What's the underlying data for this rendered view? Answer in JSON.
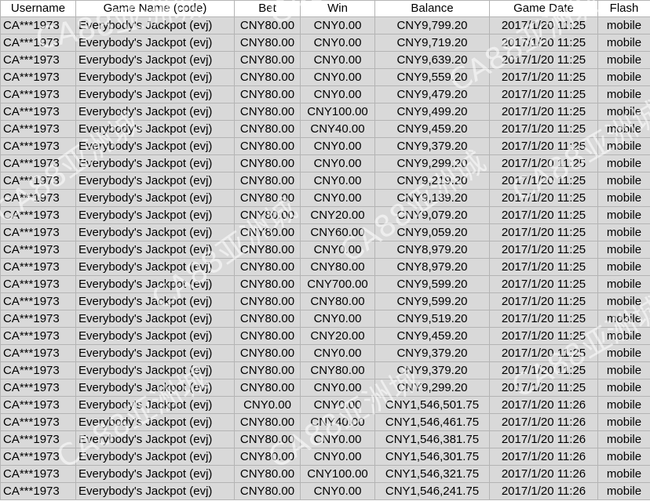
{
  "columns": [
    "Username",
    "Game Name (code)",
    "Bet",
    "Win",
    "Balance",
    "Game Date",
    "Flash"
  ],
  "rows": [
    [
      "CA***1973",
      "Everybody's Jackpot (evj)",
      "CNY80.00",
      "CNY0.00",
      "CNY9,799.20",
      "2017/1/20 11:25",
      "mobile"
    ],
    [
      "CA***1973",
      "Everybody's Jackpot (evj)",
      "CNY80.00",
      "CNY0.00",
      "CNY9,719.20",
      "2017/1/20 11:25",
      "mobile"
    ],
    [
      "CA***1973",
      "Everybody's Jackpot (evj)",
      "CNY80.00",
      "CNY0.00",
      "CNY9,639.20",
      "2017/1/20 11:25",
      "mobile"
    ],
    [
      "CA***1973",
      "Everybody's Jackpot (evj)",
      "CNY80.00",
      "CNY0.00",
      "CNY9,559.20",
      "2017/1/20 11:25",
      "mobile"
    ],
    [
      "CA***1973",
      "Everybody's Jackpot (evj)",
      "CNY80.00",
      "CNY0.00",
      "CNY9,479.20",
      "2017/1/20 11:25",
      "mobile"
    ],
    [
      "CA***1973",
      "Everybody's Jackpot (evj)",
      "CNY80.00",
      "CNY100.00",
      "CNY9,499.20",
      "2017/1/20 11:25",
      "mobile"
    ],
    [
      "CA***1973",
      "Everybody's Jackpot (evj)",
      "CNY80.00",
      "CNY40.00",
      "CNY9,459.20",
      "2017/1/20 11:25",
      "mobile"
    ],
    [
      "CA***1973",
      "Everybody's Jackpot (evj)",
      "CNY80.00",
      "CNY0.00",
      "CNY9,379.20",
      "2017/1/20 11:25",
      "mobile"
    ],
    [
      "CA***1973",
      "Everybody's Jackpot (evj)",
      "CNY80.00",
      "CNY0.00",
      "CNY9,299.20",
      "2017/1/20 11:25",
      "mobile"
    ],
    [
      "CA***1973",
      "Everybody's Jackpot (evj)",
      "CNY80.00",
      "CNY0.00",
      "CNY9,219.20",
      "2017/1/20 11:25",
      "mobile"
    ],
    [
      "CA***1973",
      "Everybody's Jackpot (evj)",
      "CNY80.00",
      "CNY0.00",
      "CNY9,139.20",
      "2017/1/20 11:25",
      "mobile"
    ],
    [
      "CA***1973",
      "Everybody's Jackpot (evj)",
      "CNY80.00",
      "CNY20.00",
      "CNY9,079.20",
      "2017/1/20 11:25",
      "mobile"
    ],
    [
      "CA***1973",
      "Everybody's Jackpot (evj)",
      "CNY80.00",
      "CNY60.00",
      "CNY9,059.20",
      "2017/1/20 11:25",
      "mobile"
    ],
    [
      "CA***1973",
      "Everybody's Jackpot (evj)",
      "CNY80.00",
      "CNY0.00",
      "CNY8,979.20",
      "2017/1/20 11:25",
      "mobile"
    ],
    [
      "CA***1973",
      "Everybody's Jackpot (evj)",
      "CNY80.00",
      "CNY80.00",
      "CNY8,979.20",
      "2017/1/20 11:25",
      "mobile"
    ],
    [
      "CA***1973",
      "Everybody's Jackpot (evj)",
      "CNY80.00",
      "CNY700.00",
      "CNY9,599.20",
      "2017/1/20 11:25",
      "mobile"
    ],
    [
      "CA***1973",
      "Everybody's Jackpot (evj)",
      "CNY80.00",
      "CNY80.00",
      "CNY9,599.20",
      "2017/1/20 11:25",
      "mobile"
    ],
    [
      "CA***1973",
      "Everybody's Jackpot (evj)",
      "CNY80.00",
      "CNY0.00",
      "CNY9,519.20",
      "2017/1/20 11:25",
      "mobile"
    ],
    [
      "CA***1973",
      "Everybody's Jackpot (evj)",
      "CNY80.00",
      "CNY20.00",
      "CNY9,459.20",
      "2017/1/20 11:25",
      "mobile"
    ],
    [
      "CA***1973",
      "Everybody's Jackpot (evj)",
      "CNY80.00",
      "CNY0.00",
      "CNY9,379.20",
      "2017/1/20 11:25",
      "mobile"
    ],
    [
      "CA***1973",
      "Everybody's Jackpot (evj)",
      "CNY80.00",
      "CNY80.00",
      "CNY9,379.20",
      "2017/1/20 11:25",
      "mobile"
    ],
    [
      "CA***1973",
      "Everybody's Jackpot (evj)",
      "CNY80.00",
      "CNY0.00",
      "CNY9,299.20",
      "2017/1/20 11:25",
      "mobile"
    ],
    [
      "CA***1973",
      "Everybody's Jackpot (evj)",
      "CNY0.00",
      "CNY0.00",
      "CNY1,546,501.75",
      "2017/1/20 11:26",
      "mobile"
    ],
    [
      "CA***1973",
      "Everybody's Jackpot (evj)",
      "CNY80.00",
      "CNY40.00",
      "CNY1,546,461.75",
      "2017/1/20 11:26",
      "mobile"
    ],
    [
      "CA***1973",
      "Everybody's Jackpot (evj)",
      "CNY80.00",
      "CNY0.00",
      "CNY1,546,381.75",
      "2017/1/20 11:26",
      "mobile"
    ],
    [
      "CA***1973",
      "Everybody's Jackpot (evj)",
      "CNY80.00",
      "CNY0.00",
      "CNY1,546,301.75",
      "2017/1/20 11:26",
      "mobile"
    ],
    [
      "CA***1973",
      "Everybody's Jackpot (evj)",
      "CNY80.00",
      "CNY100.00",
      "CNY1,546,321.75",
      "2017/1/20 11:26",
      "mobile"
    ],
    [
      "CA***1973",
      "Everybody's Jackpot (evj)",
      "CNY80.00",
      "CNY0.00",
      "CNY1,546,241.75",
      "2017/1/20 11:26",
      "mobile"
    ]
  ],
  "watermark_text": "CA88亚洲城"
}
